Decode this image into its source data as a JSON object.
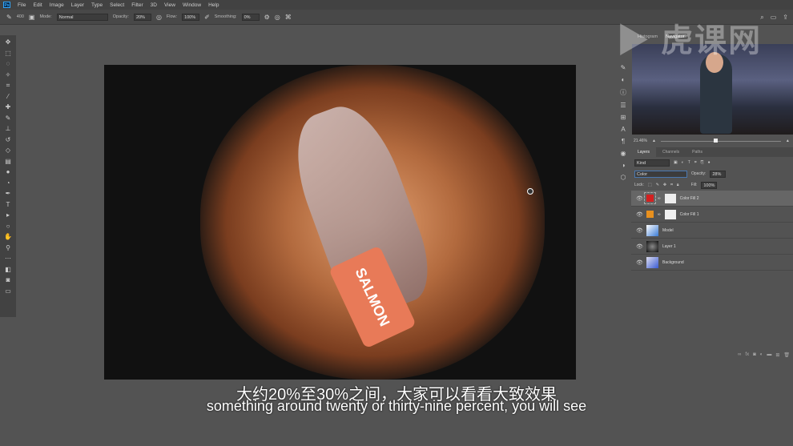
{
  "menu": [
    "File",
    "Edit",
    "Image",
    "Layer",
    "Type",
    "Select",
    "Filter",
    "3D",
    "View",
    "Window",
    "Help"
  ],
  "options": {
    "brush_size": "400",
    "mode_label": "Mode:",
    "mode": "Normal",
    "opacity_label": "Opacity:",
    "opacity": "20%",
    "flow_label": "Flow:",
    "flow": "100%",
    "smoothing_label": "Smoothing:",
    "smoothing": "0%"
  },
  "navigator": {
    "tabs": [
      "Histogram",
      "Navigator"
    ],
    "zoom": "21.46%"
  },
  "layers_panel": {
    "tabs": [
      "Layers",
      "Channels",
      "Paths"
    ],
    "filter": "Kind",
    "blend_mode": "Color",
    "opacity_label": "Opacity:",
    "opacity": "28%",
    "lock_label": "Lock:",
    "fill_label": "Fill:",
    "fill": "100%",
    "layers": [
      {
        "name": "Color Fill 2",
        "swatch": "#d42020",
        "selected": true
      },
      {
        "name": "Color Fill 1",
        "swatch": "#e8901e"
      },
      {
        "name": "Model"
      },
      {
        "name": "Layer 1"
      },
      {
        "name": "Background"
      }
    ]
  },
  "canvas": {
    "board_text": "SALMON"
  },
  "watermark": "虎课网",
  "subtitles": {
    "chinese": "大约20%至30%之间，大家可以看看大致效果",
    "english": "something around twenty or thirty-nine percent, you will see"
  }
}
